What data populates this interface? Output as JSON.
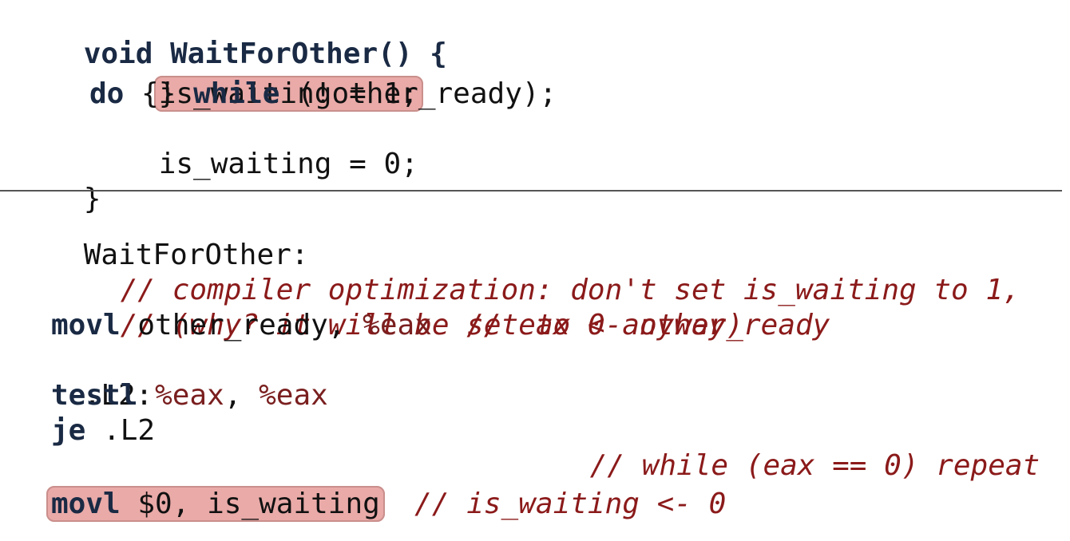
{
  "c_code": {
    "line1": "void WaitForOther() {",
    "line2": "is_waiting = 1;",
    "line3_kw1": "do",
    "line3_mid": " {} ",
    "line3_kw2": "while",
    "line3_rest": " (!other_ready);",
    "line4": "is_waiting = 0;",
    "line5": "}"
  },
  "asm": {
    "label": "WaitForOther:",
    "comment1": "// compiler optimization: don't set is_waiting to 1,",
    "comment2": "// (why? it will be set to 0 anyway)",
    "movl1_op": "movl",
    "movl1_args": " other_ready, ",
    "movl1_reg": "%eax",
    "movl1_comment": "// eax <- other_ready",
    "l2_label": ".L2:",
    "testl_op": "testl",
    "testl_reg1": "%eax",
    "testl_sep": ", ",
    "testl_reg2": "%eax",
    "je_op": "je",
    "je_arg": " .L2",
    "je_comment": "// while (eax == 0) repeat",
    "ellipsis": "...",
    "movl2_op": "movl",
    "movl2_args": " $0, is_waiting",
    "movl2_comment": "// is_waiting <- 0"
  },
  "colors": {
    "highlight": "#e9aaa8",
    "comment": "#8b1a1a",
    "keyword": "#1a2a44"
  }
}
